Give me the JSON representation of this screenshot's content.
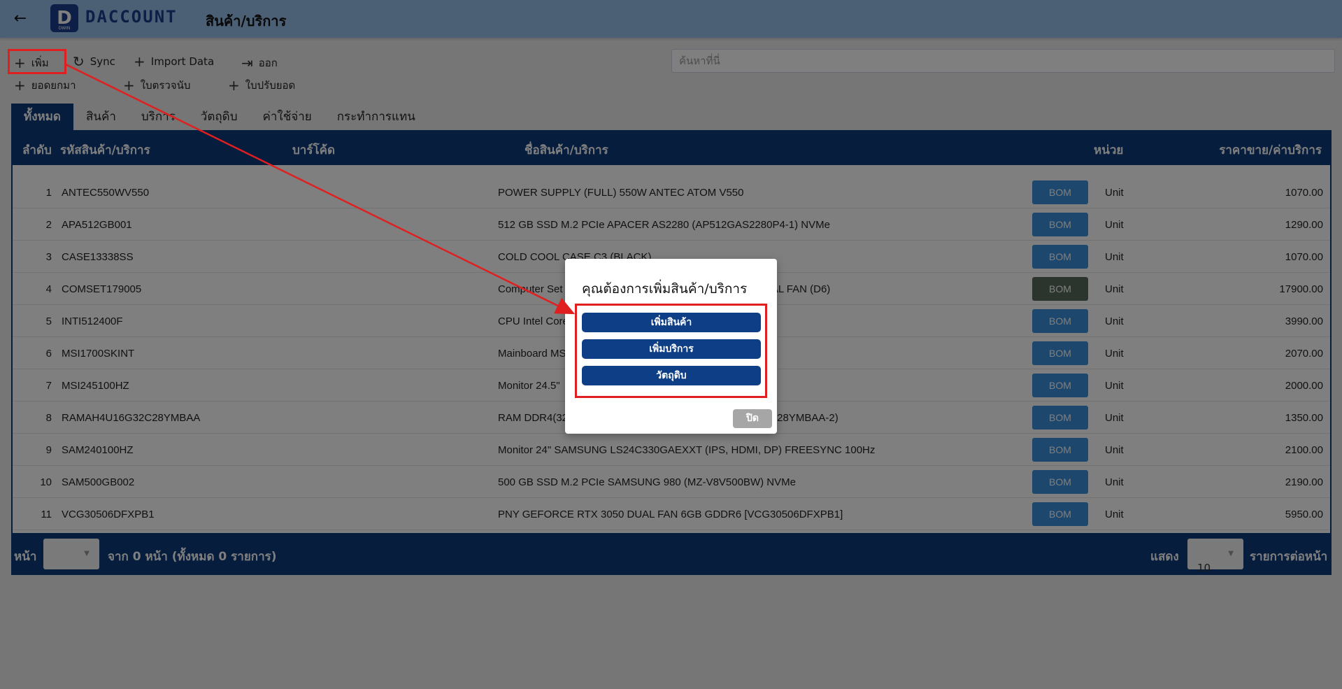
{
  "header": {
    "back_icon": "arrow-left-icon",
    "logo_mark": "D",
    "logo_sub": "DWIN",
    "logo_text": "DACCOUNT",
    "title": "สินค้า/บริการ"
  },
  "toolbar": {
    "add": "เพิ่ม",
    "sync": "Sync",
    "import": "Import Data",
    "export": "ออก",
    "carry_forward": "ยอดยกมา",
    "count_slip": "ใบตรวจนับ",
    "adjust_slip": "ใบปรับยอด"
  },
  "search": {
    "placeholder": "ค้นหาที่นี่"
  },
  "tabs": [
    "ทั้งหมด",
    "สินค้า",
    "บริการ",
    "วัตถุดิบ",
    "ค่าใช้จ่าย",
    "กระทำการแทน"
  ],
  "table": {
    "headers": {
      "index": "ลำดับ",
      "code": "รหัสสินค้า/บริการ",
      "barcode": "บาร์โค้ด",
      "name": "ชื่อสินค้า/บริการ",
      "unit": "หน่วย",
      "price": "ราคาขาย/ค่าบริการ"
    },
    "bom_label": "BOM",
    "rows": [
      {
        "no": "1",
        "code": "ANTEC550WV550",
        "name": "POWER SUPPLY (FULL) 550W ANTEC ATOM V550",
        "unit": "Unit",
        "price": "1070.00"
      },
      {
        "no": "2",
        "code": "APA512GB001",
        "name": "512 GB SSD M.2 PCIe APACER AS2280 (AP512GAS2280P4-1) NVMe",
        "unit": "Unit",
        "price": "1290.00"
      },
      {
        "no": "3",
        "code": "CASE13338SS",
        "name": "COLD COOL CASE C3 (BLACK)",
        "unit": "Unit",
        "price": "1070.00"
      },
      {
        "no": "4",
        "code": "COMSET179005",
        "name": "Computer Set",
        "name_tail": "UAL FAN (D6)",
        "unit": "Unit",
        "price": "17900.00"
      },
      {
        "no": "5",
        "code": "INTI512400F",
        "name": "CPU Intel Core",
        "unit": "Unit",
        "price": "3990.00"
      },
      {
        "no": "6",
        "code": "MSI1700SKINT",
        "name": "Mainboard MS",
        "unit": "Unit",
        "price": "2070.00"
      },
      {
        "no": "7",
        "code": "MSI245100HZ",
        "name": "Monitor 24.5\"",
        "unit": "Unit",
        "price": "2000.00"
      },
      {
        "no": "8",
        "code": "RAMAH4U16G32C28YMBAA",
        "name": "RAM DDR4(32",
        "name_tail": "2C28YMBAA-2)",
        "unit": "Unit",
        "price": "1350.00"
      },
      {
        "no": "9",
        "code": "SAM240100HZ",
        "name": "Monitor 24\" SAMSUNG LS24C330GAEXXT (IPS, HDMI, DP) FREESYNC 100Hz",
        "unit": "Unit",
        "price": "2100.00"
      },
      {
        "no": "10",
        "code": "SAM500GB002",
        "name": "500 GB SSD M.2 PCIe SAMSUNG 980 (MZ-V8V500BW) NVMe",
        "unit": "Unit",
        "price": "2190.00"
      },
      {
        "no": "11",
        "code": "VCG30506DFXPB1",
        "name": "PNY GEFORCE RTX 3050 DUAL FAN 6GB GDDR6 [VCG30506DFXPB1]",
        "unit": "Unit",
        "price": "5950.00"
      }
    ]
  },
  "pager": {
    "page_label": "หน้า",
    "summary": "จาก 0 หน้า (ทั้งหมด 0 รายการ)",
    "show_label": "แสดง",
    "per_page": "10",
    "per_page_suffix": "รายการต่อหน้า"
  },
  "modal": {
    "title": "คุณต้องการเพิ่มสินค้า/บริการ",
    "add_product": "เพิ่มสินค้า",
    "add_service": "เพิ่มบริการ",
    "raw_material": "วัตถุดิบ",
    "close": "ปิด"
  },
  "colors": {
    "header_bg": "#96bfeb",
    "brand_navy": "#0c3a7b",
    "bom_blue": "#3a8ed8",
    "highlight_red": "#e02020"
  }
}
